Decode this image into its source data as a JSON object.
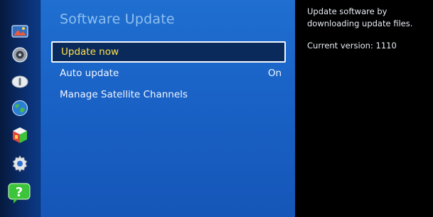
{
  "rail": {
    "icons": [
      "picture-icon",
      "sound-icon",
      "broadcast-icon",
      "network-icon",
      "system-icon",
      "support-icon",
      "help-icon"
    ]
  },
  "panel": {
    "title": "Software Update",
    "items": [
      {
        "label": "Update now",
        "value": ""
      },
      {
        "label": "Auto update",
        "value": "On"
      },
      {
        "label": "Manage Satellite Channels",
        "value": ""
      }
    ]
  },
  "info": {
    "description": "Update software by downloading update files.",
    "version": "Current version: 1110"
  },
  "colors": {
    "panel": "#1a63c7",
    "selected_text": "#ffe24a",
    "title": "#8fc0ee",
    "help_green": "#3cc43a"
  }
}
